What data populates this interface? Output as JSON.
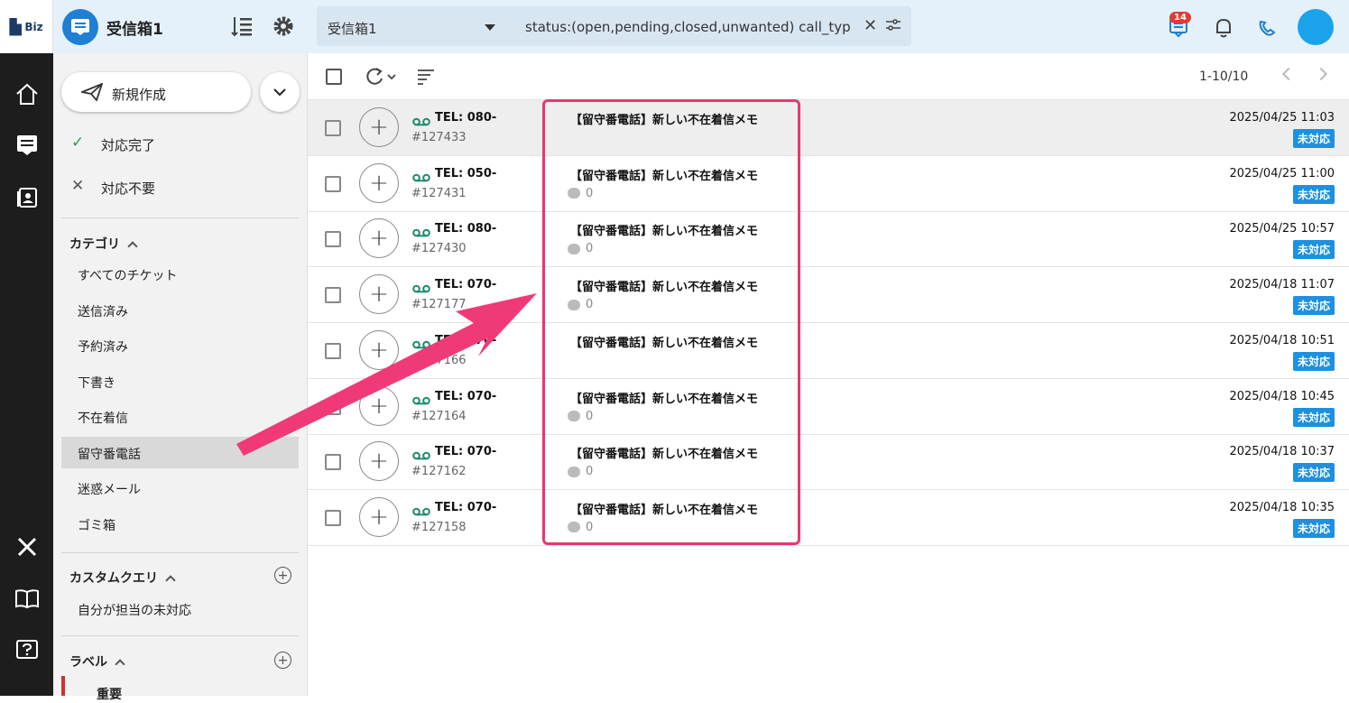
{
  "app": {
    "logo_text": "Biz",
    "inbox_title": "受信箱1"
  },
  "search": {
    "inbox_select": "受信箱1",
    "query": "status:(open,pending,closed,unwanted) call_typ"
  },
  "notifications": {
    "ticket_count": "14"
  },
  "sidebar": {
    "new_label": "新規作成",
    "status_items": [
      "対応完了",
      "対応不要"
    ],
    "category_header": "カテゴリ",
    "categories": [
      "すべてのチケット",
      "送信済み",
      "予約済み",
      "下書き",
      "不在着信",
      "留守番電話",
      "迷惑メール",
      "ゴミ箱"
    ],
    "custom_query_header": "カスタムクエリ",
    "custom_queries": [
      "自分が担当の未対応"
    ],
    "label_header": "ラベル",
    "labels": [
      "重要"
    ]
  },
  "pagination": {
    "range": "1-10/10"
  },
  "tickets": [
    {
      "tel": "TEL: 080-",
      "id": "#127433",
      "subject": "【留守番電話】新しい不在着信メモ",
      "comments": "",
      "date": "2025/04/25 11:03",
      "status": "未対応"
    },
    {
      "tel": "TEL: 050-",
      "id": "#127431",
      "subject": "【留守番電話】新しい不在着信メモ",
      "comments": "0",
      "date": "2025/04/25 11:00",
      "status": "未対応"
    },
    {
      "tel": "TEL: 080-",
      "id": "#127430",
      "subject": "【留守番電話】新しい不在着信メモ",
      "comments": "0",
      "date": "2025/04/25 10:57",
      "status": "未対応"
    },
    {
      "tel": "TEL: 070-",
      "id": "#127177",
      "subject": "【留守番電話】新しい不在着信メモ",
      "comments": "0",
      "date": "2025/04/18 11:07",
      "status": "未対応"
    },
    {
      "tel": "TEL: 070-",
      "id": "#127166",
      "subject": "【留守番電話】新しい不在着信メモ",
      "comments": "",
      "date": "2025/04/18 10:51",
      "status": "未対応"
    },
    {
      "tel": "TEL: 070-",
      "id": "#127164",
      "subject": "【留守番電話】新しい不在着信メモ",
      "comments": "0",
      "date": "2025/04/18 10:45",
      "status": "未対応"
    },
    {
      "tel": "TEL: 070-",
      "id": "#127162",
      "subject": "【留守番電話】新しい不在着信メモ",
      "comments": "0",
      "date": "2025/04/18 10:37",
      "status": "未対応"
    },
    {
      "tel": "TEL: 070-",
      "id": "#127158",
      "subject": "【留守番電話】新しい不在着信メモ",
      "comments": "0",
      "date": "2025/04/18 10:35",
      "status": "未対応"
    }
  ],
  "colors": {
    "accent": "#1e7fd4",
    "badge": "#1e90e0",
    "highlight": "#e8386d",
    "topbar": "#e4f1fb"
  }
}
